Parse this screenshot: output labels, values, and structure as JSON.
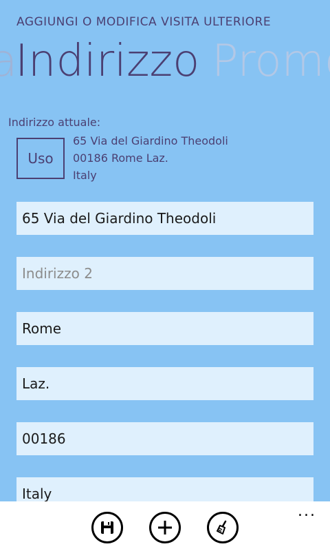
{
  "header": {
    "app_title": "AGGIUNGI O MODIFICA VISITA ULTERIORE",
    "pivot_prev_sliver": "a",
    "pivot_active": "Indirizzo",
    "pivot_next": "Prome"
  },
  "current_address": {
    "label": "Indirizzo attuale:",
    "use_label": "Uso",
    "line1": "65 Via del Giardino Theodoli",
    "line2": "00186 Rome Laz.",
    "line3": "Italy"
  },
  "form": {
    "address1": {
      "value": "65 Via del Giardino Theodoli",
      "placeholder": ""
    },
    "address2": {
      "value": "",
      "placeholder": "Indirizzo 2"
    },
    "city": {
      "value": "Rome",
      "placeholder": ""
    },
    "state": {
      "value": "Laz.",
      "placeholder": ""
    },
    "postal_code": {
      "value": "00186",
      "placeholder": ""
    },
    "country": {
      "value": "Italy",
      "placeholder": ""
    }
  },
  "appbar": {
    "buttons": [
      "save-icon",
      "add-icon",
      "clear-icon"
    ],
    "more": "..."
  }
}
